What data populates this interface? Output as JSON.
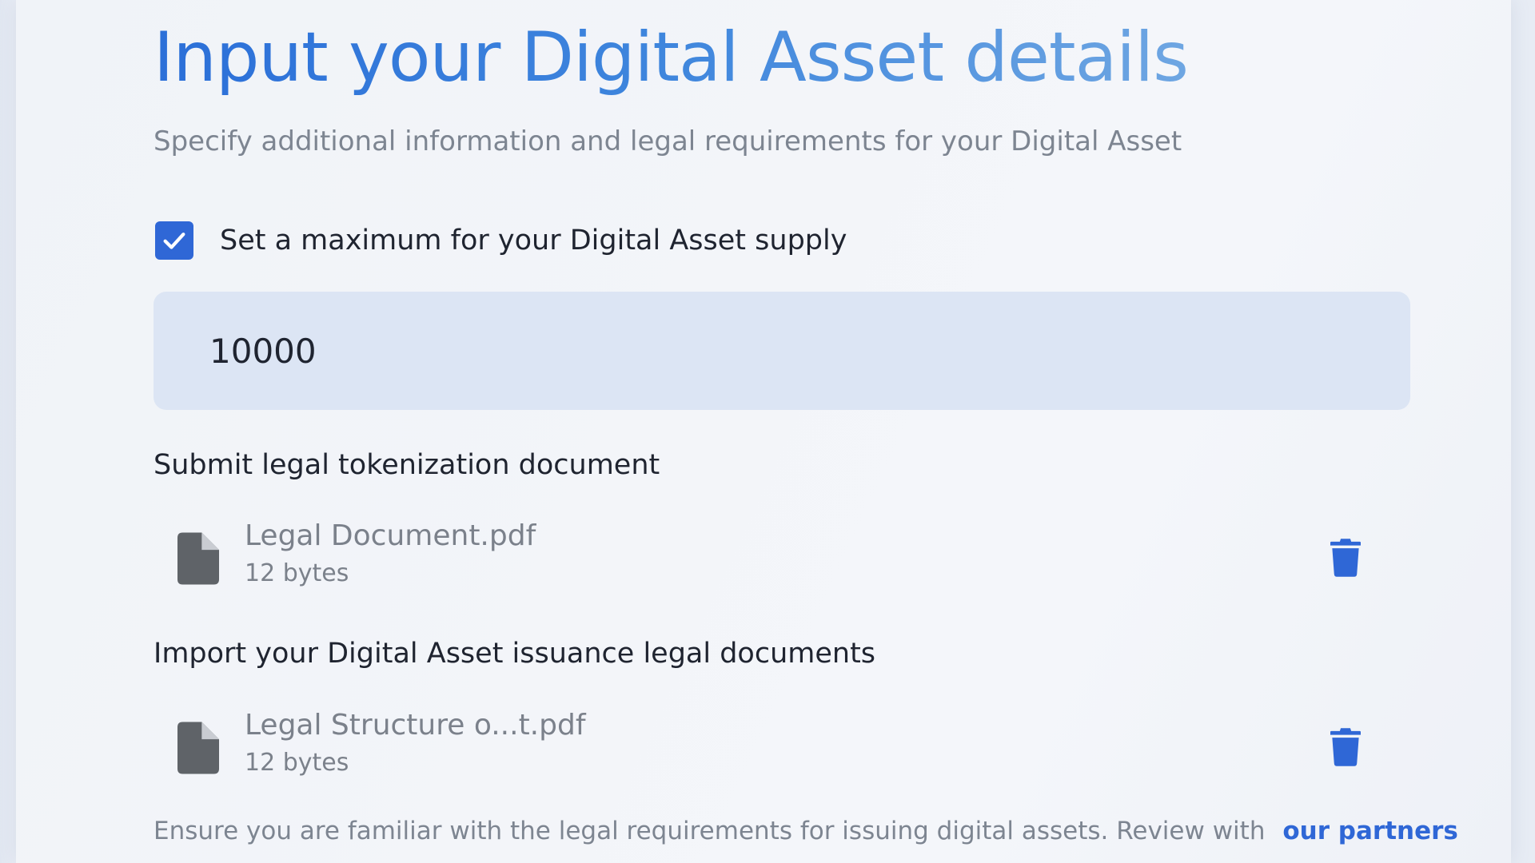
{
  "form": {
    "title": "Input your Digital Asset details",
    "subtitle": "Specify additional information and legal requirements for your Digital Asset",
    "max_supply": {
      "checkbox_label": "Set a maximum for your Digital Asset supply",
      "checked": true,
      "value": "10000"
    },
    "tokenization": {
      "label": "Submit legal tokenization document",
      "file": {
        "name": "Legal Document.pdf",
        "size": "12 bytes",
        "icon": "file-icon"
      }
    },
    "issuance": {
      "label": "Import your Digital Asset issuance legal documents",
      "file": {
        "name": "Legal Structure o...t.pdf",
        "size": "12 bytes",
        "icon": "file-icon"
      }
    },
    "footer": {
      "note": "Ensure you are familiar with the legal requirements for issuing digital assets. Review with",
      "link": "our partners"
    }
  },
  "colors": {
    "accent": "#2f67d6",
    "title_gradient_start": "#2b6fd8",
    "title_gradient_end": "#6ea6e2",
    "input_background": "#dce5f4",
    "muted_text": "#7d8591",
    "file_icon": "#5f6368"
  }
}
